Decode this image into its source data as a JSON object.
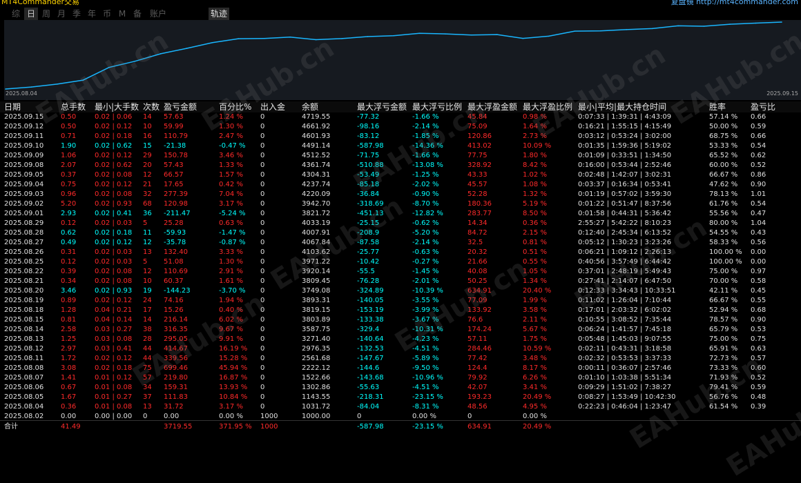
{
  "topbar": {
    "title": "MT4Commander交易",
    "right": "复盘镜 http://mt4commander.com"
  },
  "tabs": [
    "综",
    "日",
    "周",
    "月",
    "季",
    "年",
    "币",
    "M",
    "备",
    "账户",
    "轨迹"
  ],
  "chart": {
    "date_start": "2025.08.04",
    "date_end": "2025.09.15"
  },
  "watermark": "EAHub.cn",
  "chart_data": {
    "type": "line",
    "x": [
      "2025.08.04",
      "2025.08.05",
      "2025.08.06",
      "2025.08.07",
      "2025.08.08",
      "2025.08.11",
      "2025.08.12",
      "2025.08.13",
      "2025.08.14",
      "2025.08.15",
      "2025.08.18",
      "2025.08.19",
      "2025.08.20",
      "2025.08.21",
      "2025.08.22",
      "2025.08.25",
      "2025.08.26",
      "2025.08.27",
      "2025.08.28",
      "2025.08.29",
      "2025.09.01",
      "2025.09.02",
      "2025.09.03",
      "2025.09.04",
      "2025.09.05",
      "2025.09.08",
      "2025.09.09",
      "2025.09.10",
      "2025.09.11",
      "2025.09.12",
      "2025.09.15"
    ],
    "y": [
      1031.72,
      1143.55,
      1302.86,
      1522.66,
      2222.12,
      2561.68,
      2976.35,
      3271.4,
      3587.75,
      3803.89,
      3819.15,
      3893.31,
      3749.08,
      3809.45,
      3920.14,
      3971.22,
      4103.62,
      4067.84,
      4007.91,
      4033.19,
      3821.72,
      3942.7,
      4220.09,
      4237.74,
      4304.31,
      4361.74,
      4512.52,
      4491.14,
      4601.93,
      4661.92,
      4719.55
    ],
    "title": "",
    "xlabel": "",
    "ylabel": "",
    "grid": false,
    "color": "#19b6ff"
  },
  "table": {
    "headers": [
      "日期",
      "总手数",
      "最小|大手数",
      "次数",
      "盈亏金额",
      "百分比%",
      "出入金",
      "余额",
      "最大浮亏金额",
      "最大浮亏比例",
      "最大浮盈金额",
      "最大浮盈比例",
      "最小|平均|最大持仓时间",
      "胜率",
      "盈亏比"
    ],
    "rows": [
      [
        "2025.09.15",
        "0.50",
        "0.02 | 0.06",
        "14",
        "57.63",
        "1.24 %",
        "0",
        "4719.55",
        "-77.32",
        "-1.66 %",
        "45.84",
        "0.98 %",
        "0:07:33 | 1:39:31 | 4:43:09",
        "57.14 %",
        "0.66"
      ],
      [
        "2025.09.12",
        "0.50",
        "0.02 | 0.12",
        "10",
        "59.99",
        "1.30 %",
        "0",
        "4661.92",
        "-98.16",
        "-2.14 %",
        "75.09",
        "1.64 %",
        "0:16:21 | 1:55:15 | 4:15:49",
        "50.00 %",
        "0.59"
      ],
      [
        "2025.09.11",
        "0.71",
        "0.02 | 0.18",
        "16",
        "110.79",
        "2.47 %",
        "0",
        "4601.93",
        "-83.12",
        "-1.85 %",
        "120.86",
        "2.73 %",
        "0:03:12 | 0:53:24 | 3:02:00",
        "68.75 %",
        "0.66"
      ],
      [
        "2025.09.10",
        "1.90",
        "0.02 | 0.62",
        "15",
        "-21.38",
        "-0.47 %",
        "0",
        "4491.14",
        "-587.98",
        "-14.36 %",
        "413.02",
        "10.09 %",
        "0:01:35 | 1:59:36 | 5:19:02",
        "53.33 %",
        "0.54"
      ],
      [
        "2025.09.09",
        "1.06",
        "0.02 | 0.12",
        "29",
        "150.78",
        "3.46 %",
        "0",
        "4512.52",
        "-71.75",
        "-1.66 %",
        "77.75",
        "1.80 %",
        "0:01:09 | 0:33:51 | 1:34:50",
        "65.52 %",
        "0.62"
      ],
      [
        "2025.09.08",
        "2.07",
        "0.02 | 0.62",
        "20",
        "57.43",
        "1.33 %",
        "0",
        "4361.74",
        "-510.88",
        "-13.08 %",
        "328.92",
        "8.42 %",
        "0:16:00 | 0:53:44 | 2:52:46",
        "60.00 %",
        "0.52"
      ],
      [
        "2025.09.05",
        "0.37",
        "0.02 | 0.08",
        "12",
        "66.57",
        "1.57 %",
        "0",
        "4304.31",
        "-53.49",
        "-1.25 %",
        "43.33",
        "1.02 %",
        "0:02:48 | 1:42:07 | 3:02:31",
        "66.67 %",
        "0.86"
      ],
      [
        "2025.09.04",
        "0.75",
        "0.02 | 0.12",
        "21",
        "17.65",
        "0.42 %",
        "0",
        "4237.74",
        "-85.18",
        "-2.02 %",
        "45.57",
        "1.08 %",
        "0:03:37 | 0:16:34 | 0:53:41",
        "47.62 %",
        "0.90"
      ],
      [
        "2025.09.03",
        "0.96",
        "0.02 | 0.08",
        "32",
        "277.39",
        "7.04 %",
        "0",
        "4220.09",
        "-36.84",
        "-0.90 %",
        "52.28",
        "1.32 %",
        "0:01:19 | 0:57:02 | 3:59:30",
        "78.13 %",
        "1.01"
      ],
      [
        "2025.09.02",
        "5.20",
        "0.02 | 0.93",
        "68",
        "120.98",
        "3.17 %",
        "0",
        "3942.70",
        "-318.69",
        "-8.70 %",
        "180.36",
        "5.19 %",
        "0:01:22 | 0:51:47 | 8:37:56",
        "61.76 %",
        "0.54"
      ],
      [
        "2025.09.01",
        "2.93",
        "0.02 | 0.41",
        "36",
        "-211.47",
        "-5.24 %",
        "0",
        "3821.72",
        "-451.13",
        "-12.82 %",
        "283.77",
        "8.50 %",
        "0:01:58 | 0:44:31 | 5:36:42",
        "55.56 %",
        "0.47"
      ],
      [
        "2025.08.29",
        "0.12",
        "0.02 | 0.03",
        "5",
        "25.28",
        "0.63 %",
        "0",
        "4033.19",
        "-25.15",
        "-0.62 %",
        "14.34",
        "0.36 %",
        "2:55:27 | 5:42:22 | 8:10:23",
        "80.00 %",
        "1.04"
      ],
      [
        "2025.08.28",
        "0.62",
        "0.02 | 0.18",
        "11",
        "-59.93",
        "-1.47 %",
        "0",
        "4007.91",
        "-208.9",
        "-5.20 %",
        "84.72",
        "2.15 %",
        "0:12:40 | 2:45:34 | 6:13:52",
        "54.55 %",
        "0.43"
      ],
      [
        "2025.08.27",
        "0.49",
        "0.02 | 0.12",
        "12",
        "-35.78",
        "-0.87 %",
        "0",
        "4067.84",
        "-87.58",
        "-2.14 %",
        "32.5",
        "0.81 %",
        "0:05:12 | 1:30:23 | 3:23:26",
        "58.33 %",
        "0.56"
      ],
      [
        "2025.08.26",
        "0.31",
        "0.02 | 0.03",
        "13",
        "132.40",
        "3.33 %",
        "0",
        "4103.62",
        "-25.77",
        "-0.63 %",
        "20.32",
        "0.51 %",
        "0:06:21 | 1:09:12 | 2:26:13",
        "100.00 %",
        "0.00"
      ],
      [
        "2025.08.25",
        "0.12",
        "0.02 | 0.03",
        "5",
        "51.08",
        "1.30 %",
        "0",
        "3971.22",
        "-10.42",
        "-0.27 %",
        "21.66",
        "0.55 %",
        "0:40:56 | 3:57:49 | 6:44:42",
        "100.00 %",
        "0.00"
      ],
      [
        "2025.08.22",
        "0.39",
        "0.02 | 0.08",
        "12",
        "110.69",
        "2.91 %",
        "0",
        "3920.14",
        "-55.5",
        "-1.45 %",
        "40.08",
        "1.05 %",
        "0:37:01 | 2:48:19 | 5:49:43",
        "75.00 %",
        "0.97"
      ],
      [
        "2025.08.21",
        "0.34",
        "0.02 | 0.08",
        "10",
        "60.37",
        "1.61 %",
        "0",
        "3809.45",
        "-76.28",
        "-2.01 %",
        "50.25",
        "1.34 %",
        "0:27:41 | 2:14:07 | 6:47:50",
        "70.00 %",
        "0.58"
      ],
      [
        "2025.08.20",
        "3.46",
        "0.02 | 0.93",
        "19",
        "-144.23",
        "-3.70 %",
        "0",
        "3749.08",
        "-324.89",
        "-10.39 %",
        "634.91",
        "20.40 %",
        "0:12:33 | 3:34:43 | 10:33:51",
        "42.11 %",
        "0.45"
      ],
      [
        "2025.08.19",
        "0.89",
        "0.02 | 0.12",
        "24",
        "74.16",
        "1.94 %",
        "0",
        "3893.31",
        "-140.05",
        "-3.55 %",
        "77.09",
        "1.99 %",
        "0:11:02 | 1:26:04 | 7:10:44",
        "66.67 %",
        "0.55"
      ],
      [
        "2025.08.18",
        "1.28",
        "0.04 | 0.21",
        "17",
        "15.26",
        "0.40 %",
        "0",
        "3819.15",
        "-153.19",
        "-3.99 %",
        "133.92",
        "3.58 %",
        "0:17:01 | 2:03:32 | 6:02:02",
        "52.94 %",
        "0.68"
      ],
      [
        "2025.08.15",
        "0.81",
        "0.04 | 0.14",
        "14",
        "216.14",
        "6.02 %",
        "0",
        "3803.89",
        "-133.38",
        "-3.67 %",
        "76.6",
        "2.11 %",
        "0:10:55 | 3:08:52 | 7:35:44",
        "78.57 %",
        "0.90"
      ],
      [
        "2025.08.14",
        "2.58",
        "0.03 | 0.27",
        "38",
        "316.35",
        "9.67 %",
        "0",
        "3587.75",
        "-329.4",
        "-10.31 %",
        "174.24",
        "5.67 %",
        "0:06:24 | 1:41:57 | 7:45:18",
        "65.79 %",
        "0.53"
      ],
      [
        "2025.08.13",
        "1.25",
        "0.03 | 0.08",
        "28",
        "295.05",
        "9.91 %",
        "0",
        "3271.40",
        "-140.64",
        "-4.23 %",
        "57.11",
        "1.75 %",
        "0:05:48 | 1:45:03 | 9:07:55",
        "75.00 %",
        "0.75"
      ],
      [
        "2025.08.12",
        "2.97",
        "0.03 | 0.41",
        "44",
        "414.67",
        "16.19 %",
        "0",
        "2976.35",
        "-132.53",
        "-4.51 %",
        "284.46",
        "10.59 %",
        "0:02:11 | 0:43:31 | 3:18:58",
        "65.91 %",
        "0.63"
      ],
      [
        "2025.08.11",
        "1.72",
        "0.02 | 0.12",
        "44",
        "339.56",
        "15.28 %",
        "0",
        "2561.68",
        "-147.67",
        "-5.89 %",
        "77.42",
        "3.48 %",
        "0:02:32 | 0:53:53 | 3:37:33",
        "72.73 %",
        "0.57"
      ],
      [
        "2025.08.08",
        "3.08",
        "0.02 | 0.18",
        "75",
        "699.46",
        "45.94 %",
        "0",
        "2222.12",
        "-144.6",
        "-9.50 %",
        "124.4",
        "8.17 %",
        "0:00:11 | 0:36:07 | 2:57:46",
        "73.33 %",
        "0.60"
      ],
      [
        "2025.08.07",
        "1.41",
        "0.01 | 0.12",
        "57",
        "219.80",
        "16.87 %",
        "0",
        "1522.66",
        "-143.68",
        "-10.96 %",
        "79.92",
        "6.26 %",
        "0:01:10 | 1:03:38 | 5:51:34",
        "71.93 %",
        "0.52"
      ],
      [
        "2025.08.06",
        "0.67",
        "0.01 | 0.08",
        "34",
        "159.31",
        "13.93 %",
        "0",
        "1302.86",
        "-55.63",
        "-4.51 %",
        "42.07",
        "3.41 %",
        "0:09:29 | 1:51:02 | 7:38:27",
        "79.41 %",
        "0.59"
      ],
      [
        "2025.08.05",
        "1.67",
        "0.01 | 0.27",
        "37",
        "111.83",
        "10.84 %",
        "0",
        "1143.55",
        "-218.31",
        "-23.15 %",
        "193.23",
        "20.49 %",
        "0:08:27 | 1:53:49 | 10:42:30",
        "56.76 %",
        "0.48"
      ],
      [
        "2025.08.04",
        "0.36",
        "0.01 | 0.08",
        "13",
        "31.72",
        "3.17 %",
        "0",
        "1031.72",
        "-84.04",
        "-8.31 %",
        "48.56",
        "4.95 %",
        "0:22:23 | 0:46:04 | 1:23:47",
        "61.54 %",
        "0.39"
      ],
      [
        "2025.08.02",
        "0.00",
        "0.00 | 0.00",
        "0",
        "0.00",
        "0.00 %",
        "1000",
        "1000.00",
        "0",
        "0.00 %",
        "0",
        "0.00 %",
        "",
        "",
        ""
      ]
    ],
    "total": [
      "合计",
      "41.49",
      "",
      "",
      "3719.55",
      "371.95 %",
      "1000",
      "",
      "-587.98",
      "-23.15 %",
      "634.91",
      "20.49 %",
      "",
      "",
      ""
    ]
  },
  "colors": {
    "profit": "#ff2a2a",
    "loss": "#00ffff",
    "neutral": "#e0e0e0",
    "line": "#19b6ff"
  }
}
